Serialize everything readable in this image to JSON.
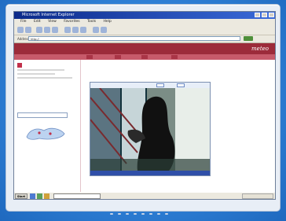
{
  "colors": {
    "background_blue": "#2a7bd3",
    "site_header": "#9c2b3a",
    "heading_red": "#c1304a",
    "link_blue": "#2a4fa0"
  },
  "window": {
    "title": "Microsoft Internet Explorer",
    "menu": [
      "File",
      "Edit",
      "View",
      "Favorites",
      "Tools",
      "Help"
    ],
    "address_label": "Address",
    "address_value": "http://"
  },
  "site": {
    "brand": "meteo",
    "nav": [
      "",
      "",
      ""
    ],
    "subnav_tabs": [
      "",
      "",
      "",
      ""
    ]
  },
  "sidebar": {
    "section_title": "",
    "dropdown_value": "",
    "links": [
      "",
      "",
      "",
      "",
      "",
      ""
    ]
  },
  "content": {
    "breadcrumb": "",
    "heading": "",
    "video_label": "",
    "video_footer": [
      "",
      ""
    ]
  },
  "taskbar": {
    "start_label": "Start",
    "task_label": ""
  }
}
